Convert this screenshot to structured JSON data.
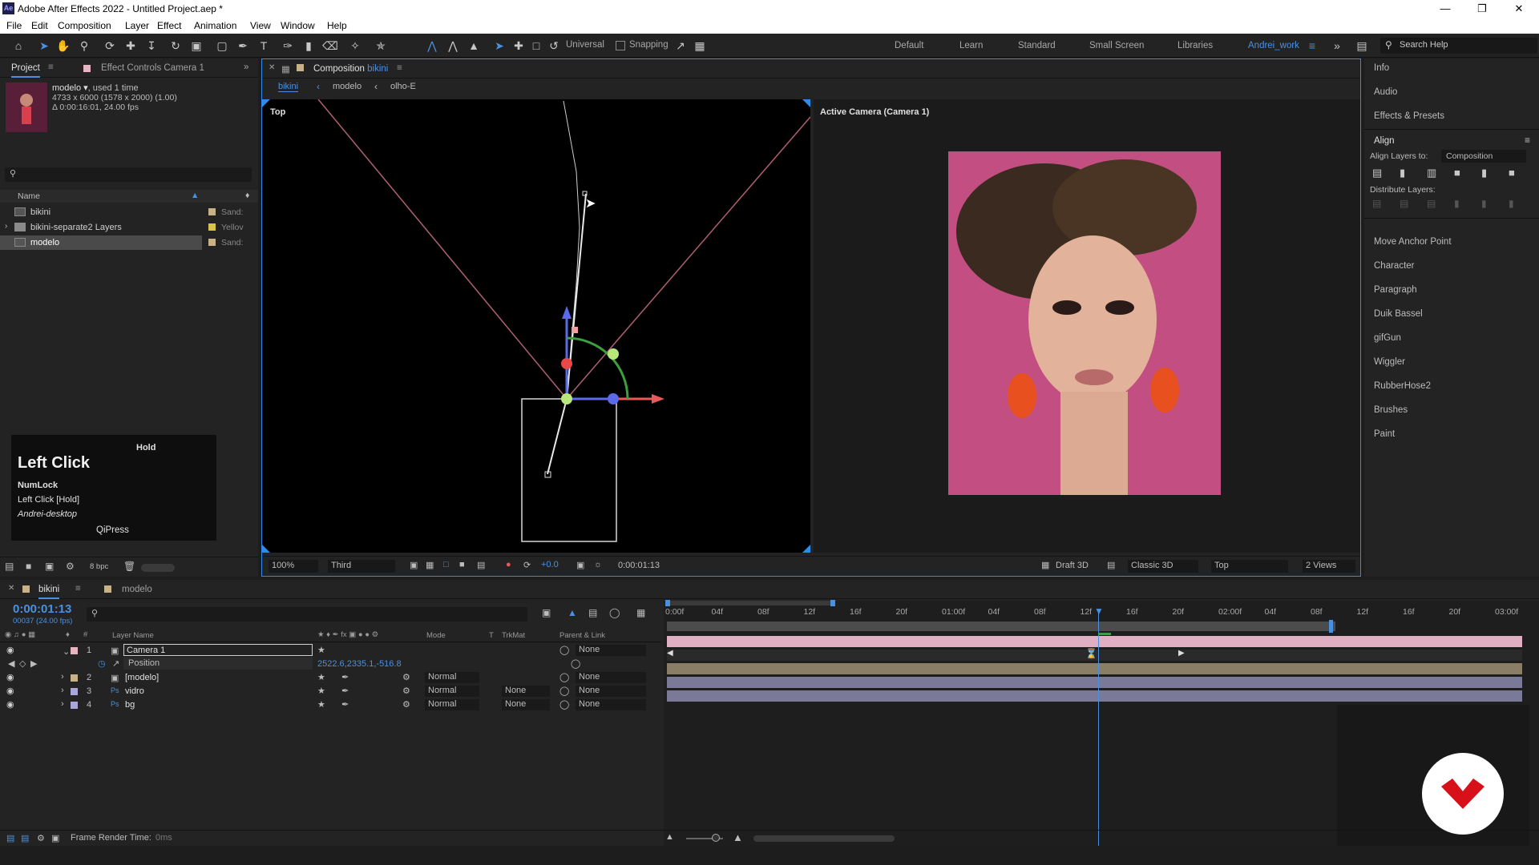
{
  "window": {
    "title": "Adobe After Effects 2022 - Untitled Project.aep *",
    "app_icon": "Ae",
    "controls": [
      "minimize-icon",
      "restore-icon",
      "close-icon"
    ]
  },
  "menu": [
    "File",
    "Edit",
    "Composition",
    "Layer",
    "Effect",
    "Animation",
    "View",
    "Window",
    "Help"
  ],
  "toolbar": {
    "axis_mode": "Universal",
    "snapping": "Snapping",
    "workspaces": [
      "Default",
      "Learn",
      "Standard",
      "Small Screen",
      "Libraries",
      "Andrei_work"
    ],
    "search_placeholder": "Search Help"
  },
  "project": {
    "tab": "Project",
    "tab2": "Effect Controls Camera 1",
    "selected_name": "modelo ▾",
    "used": ", used 1 time",
    "info1": "4733 x 6000  (1578 x 2000) (1.00)",
    "info2": "Δ 0:00:16:01, 24.00 fps",
    "col_name": "Name",
    "items": [
      {
        "name": "bikini",
        "label": "Sand:",
        "color": "#c8b28a"
      },
      {
        "name": "bikini-separate2 Layers",
        "label": "Yellov",
        "color": "#d9c44a"
      },
      {
        "name": "modelo",
        "label": "Sand:",
        "color": "#c8b28a"
      }
    ],
    "bpc": "8 bpc"
  },
  "overlay": {
    "title": "Left Click",
    "hold": "Hold",
    "line1": "NumLock",
    "line2": "Left Click [Hold]",
    "line3": "Andrei-desktop",
    "footer": "QiPress"
  },
  "composition": {
    "tab_prefix": "Composition",
    "tab_name": "bikini",
    "breadcrumbs": [
      "bikini",
      "modelo",
      "olho-E"
    ],
    "left_view_label": "Top",
    "right_view_label": "Active Camera (Camera 1)",
    "zoom": "100%",
    "resolution": "Third",
    "exposure": "+0.0",
    "timecode": "0:00:01:13",
    "renderer_draft": "Draft 3D",
    "renderer": "Classic 3D",
    "view": "Top",
    "views": "2 Views"
  },
  "right_panels": {
    "items": [
      "Info",
      "Audio",
      "Effects & Presets",
      "Align"
    ],
    "align_layers_to_label": "Align Layers to:",
    "align_layers_to_value": "Composition",
    "distribute_label": "Distribute Layers:",
    "more": [
      "Move Anchor Point",
      "Character",
      "Paragraph",
      "Duik Bassel",
      "gifGun",
      "Wiggler",
      "RubberHose2",
      "Brushes",
      "Paint"
    ]
  },
  "timeline": {
    "tabs": [
      "bikini",
      "modelo"
    ],
    "timecode": "0:00:01:13",
    "frames": "00037 (24.00 fps)",
    "columns": {
      "layer_name": "Layer Name",
      "mode": "Mode",
      "t": "T",
      "trkmat": "TrkMat",
      "parent": "Parent & Link"
    },
    "ruler": [
      "0:00f",
      "04f",
      "08f",
      "12f",
      "16f",
      "20f",
      "01:00f",
      "04f",
      "08f",
      "12f",
      "16f",
      "20f",
      "02:00f",
      "04f",
      "08f",
      "12f",
      "16f",
      "20f",
      "03:00f"
    ],
    "layers": [
      {
        "num": "1",
        "name": "Camera 1",
        "mode": "",
        "trkmat": "",
        "parent": "None",
        "color": "#e8b4c4"
      },
      {
        "num": "2",
        "name": "[modelo]",
        "mode": "Normal",
        "trkmat": "",
        "parent": "None",
        "color": "#c8b28a"
      },
      {
        "num": "3",
        "name": "vidro",
        "mode": "Normal",
        "trkmat": "None",
        "parent": "None",
        "color": "#a8a8d8"
      },
      {
        "num": "4",
        "name": "bg",
        "mode": "Normal",
        "trkmat": "None",
        "parent": "None",
        "color": "#a8a8d8"
      }
    ],
    "position_label": "Position",
    "position_value": "2522.6,2335.1,-516.8",
    "footer": "Frame Render Time:",
    "footer_value": "0ms"
  },
  "colors": {
    "accent": "#2d8ceb",
    "camera_bar": "#e0b0c2",
    "footage_bar": "#8a7f66",
    "solid_bar": "#7a7a98",
    "brand_badge": "#d8101a"
  }
}
